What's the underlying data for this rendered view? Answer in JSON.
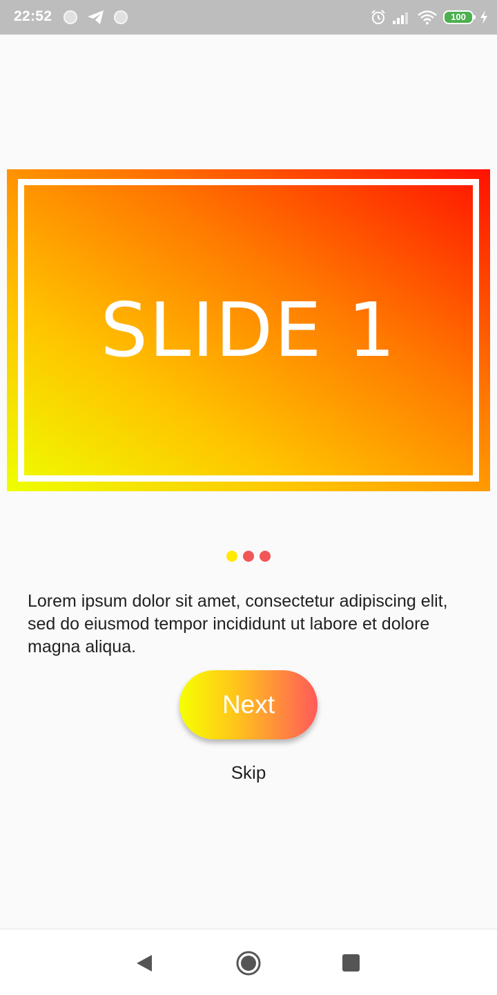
{
  "status_bar": {
    "time": "22:52",
    "battery_level": "100",
    "icons": [
      "notification-dot-icon",
      "telegram-icon",
      "notification-dot-icon",
      "alarm-icon",
      "signal-icon",
      "wifi-icon",
      "battery-icon",
      "charging-icon"
    ]
  },
  "slide": {
    "title": "SLIDE 1",
    "gradient_colors": [
      "#eeff00",
      "#ffc400",
      "#ff7a00",
      "#ff1100"
    ]
  },
  "page_indicator": {
    "count": 3,
    "active_index": 0,
    "active_color": "#ffea00",
    "inactive_color": "#f25656"
  },
  "description": "Lorem ipsum dolor sit amet, consectetur adipiscing elit, sed do eiusmod tempor incididunt ut labore et dolore magna aliqua.",
  "next_button": {
    "label": "Next",
    "gradient_colors": [
      "#f6ff00",
      "#ffc61a",
      "#ff5a5a"
    ]
  },
  "skip_button": {
    "label": "Skip"
  },
  "nav_bar": {
    "icons": [
      "back-icon",
      "home-icon",
      "recents-icon"
    ],
    "icon_color": "#555555"
  }
}
